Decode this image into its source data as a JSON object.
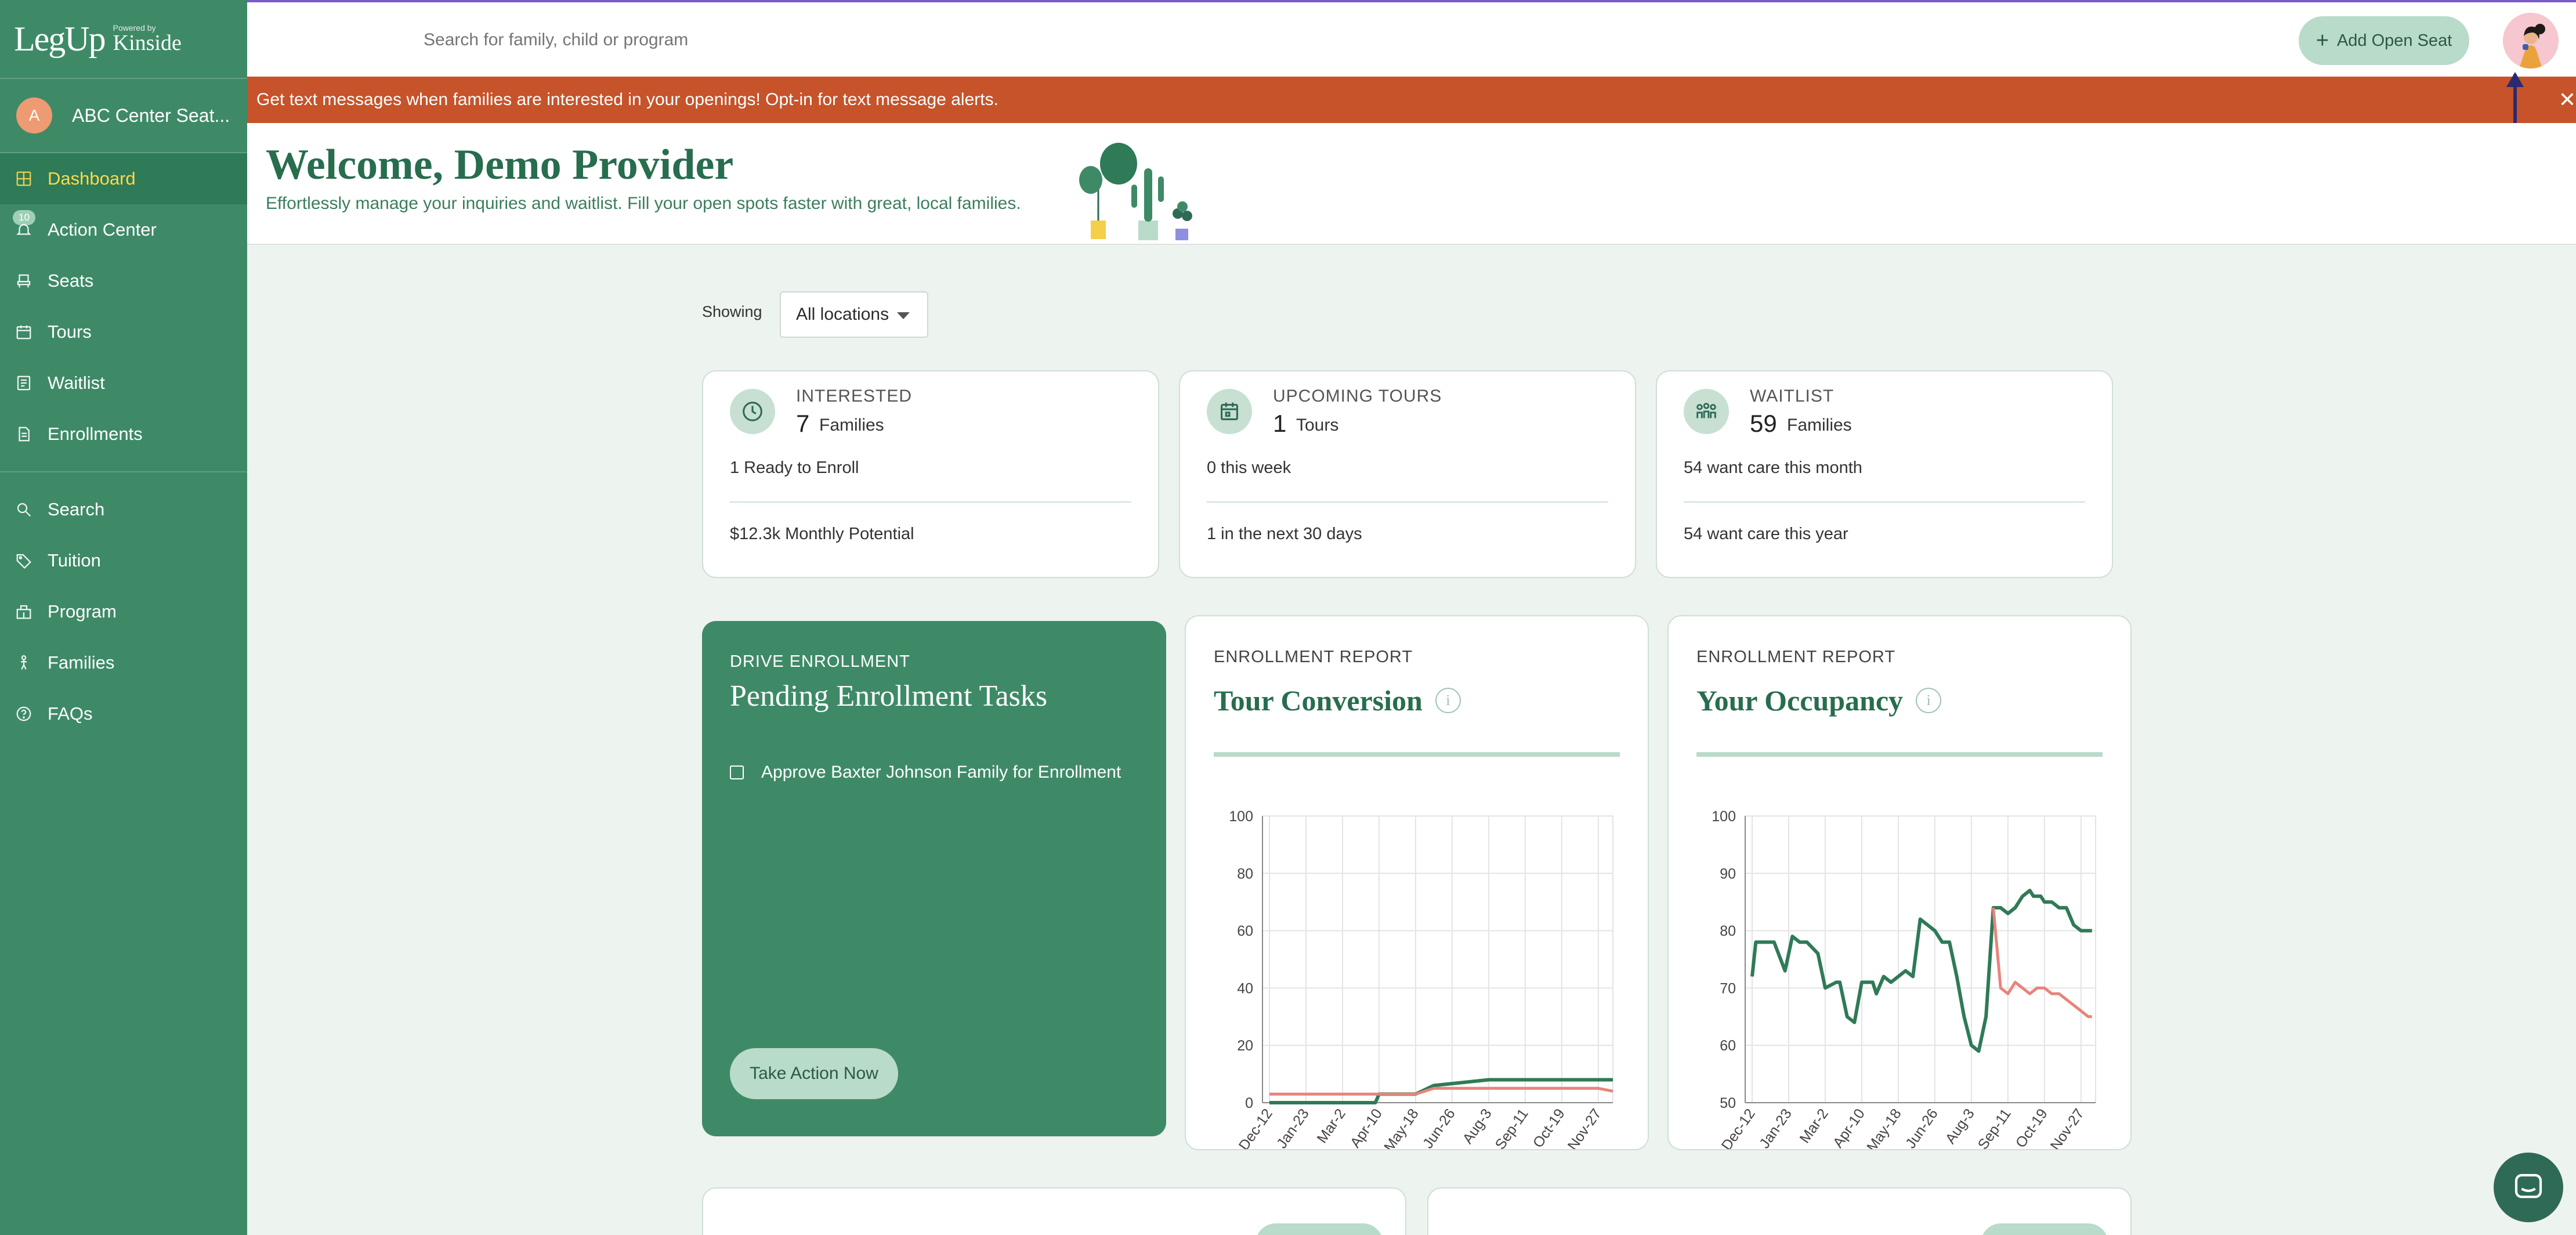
{
  "brand": {
    "logo": "LegUp",
    "powered_by": "Powered by",
    "partner": "Kinside"
  },
  "center": {
    "initial": "A",
    "name": "ABC Center Seat..."
  },
  "nav": {
    "primary": [
      {
        "label": "Dashboard",
        "icon": "dashboard-icon",
        "active": true
      },
      {
        "label": "Action Center",
        "icon": "bell-icon",
        "badge": "10"
      },
      {
        "label": "Seats",
        "icon": "seat-icon"
      },
      {
        "label": "Tours",
        "icon": "calendar-icon"
      },
      {
        "label": "Waitlist",
        "icon": "list-icon"
      },
      {
        "label": "Enrollments",
        "icon": "document-icon"
      }
    ],
    "secondary": [
      {
        "label": "Search",
        "icon": "search-icon"
      },
      {
        "label": "Tuition",
        "icon": "tag-icon"
      },
      {
        "label": "Program",
        "icon": "building-icon"
      },
      {
        "label": "Families",
        "icon": "person-icon"
      },
      {
        "label": "FAQs",
        "icon": "question-icon"
      }
    ]
  },
  "topbar": {
    "search_placeholder": "Search for family, child or program",
    "add_seat_label": "Add Open Seat"
  },
  "banner": {
    "text": "Get text messages when families are interested in your openings! Opt-in for text message alerts."
  },
  "welcome": {
    "title": "Welcome, Demo Provider",
    "subtitle": "Effortlessly manage your inquiries and waitlist. Fill your open spots faster with great, local families."
  },
  "filter": {
    "label": "Showing",
    "value": "All locations"
  },
  "stats": [
    {
      "title": "INTERESTED",
      "number": "7",
      "unit": "Families",
      "line1": "1 Ready to Enroll",
      "line2": "$12.3k Monthly Potential",
      "icon": "clock-icon"
    },
    {
      "title": "UPCOMING TOURS",
      "number": "1",
      "unit": "Tours",
      "line1": "0 this week",
      "line2": "1 in the next 30 days",
      "icon": "calendar-icon"
    },
    {
      "title": "WAITLIST",
      "number": "59",
      "unit": "Families",
      "line1": "54 want care this month",
      "line2": "54 want care this year",
      "icon": "people-icon"
    }
  ],
  "tasks": {
    "kicker": "DRIVE ENROLLMENT",
    "title": "Pending Enrollment Tasks",
    "items": [
      "Approve Baxter Johnson Family for Enrollment"
    ],
    "action_label": "Take Action Now"
  },
  "colors": {
    "primary": "#3e8a67",
    "accent_light": "#b9dbc9",
    "banner": "#c6532a",
    "series_green": "#2f7a57",
    "series_red": "#e8847b"
  },
  "chart_data": [
    {
      "type": "line",
      "kicker": "ENROLLMENT REPORT",
      "title": "Tour Conversion",
      "categories": [
        "Dec-12",
        "Jan-23",
        "Mar-2",
        "Apr-10",
        "May-18",
        "Jun-26",
        "Aug-3",
        "Sep-11",
        "Oct-19",
        "Nov-27"
      ],
      "ylim": [
        0,
        100
      ],
      "yticks": [
        0,
        20,
        40,
        60,
        80,
        100
      ],
      "grid": true,
      "series": [
        {
          "color": "#2f7a57",
          "x": [
            0,
            0.5,
            1,
            2,
            2.9,
            3,
            4,
            4.5,
            6,
            7,
            8,
            9,
            9.4
          ],
          "values": [
            0,
            0,
            0,
            0,
            0,
            3,
            3,
            6,
            8,
            8,
            8,
            8,
            8
          ]
        },
        {
          "color": "#e8847b",
          "x": [
            0,
            1,
            2,
            3,
            4,
            4.5,
            5,
            6,
            7,
            8,
            9,
            9.4
          ],
          "values": [
            3,
            3,
            3,
            3,
            3,
            5,
            5,
            5,
            5,
            5,
            5,
            4
          ]
        }
      ]
    },
    {
      "type": "line",
      "kicker": "ENROLLMENT REPORT",
      "title": "Your Occupancy",
      "categories": [
        "Dec-12",
        "Jan-23",
        "Mar-2",
        "Apr-10",
        "May-18",
        "Jun-26",
        "Aug-3",
        "Sep-11",
        "Oct-19",
        "Nov-27"
      ],
      "ylim": [
        50,
        100
      ],
      "yticks": [
        50,
        60,
        70,
        80,
        90,
        100
      ],
      "grid": true,
      "series": [
        {
          "color": "#2f7a57",
          "x": [
            0,
            0.1,
            0.6,
            0.9,
            1.1,
            1.3,
            1.5,
            1.8,
            2,
            2.3,
            2.4,
            2.6,
            2.8,
            3,
            3.2,
            3.3,
            3.4,
            3.6,
            3.8,
            4,
            4.2,
            4.4,
            4.6,
            4.8,
            5,
            5.2,
            5.4,
            5.6,
            5.8,
            6,
            6.2,
            6.4,
            6.6,
            6.8,
            7,
            7.2,
            7.4,
            7.6,
            7.7,
            7.8,
            7.9,
            8,
            8.2,
            8.4,
            8.6,
            8.8,
            9,
            9.2,
            9.3
          ],
          "values": [
            72,
            78,
            78,
            73,
            79,
            78,
            78,
            76,
            70,
            71,
            71,
            65,
            64,
            71,
            71,
            71,
            69,
            72,
            71,
            72,
            73,
            72,
            82,
            81,
            80,
            78,
            78,
            72,
            65,
            60,
            59,
            65,
            84,
            84,
            83,
            84,
            86,
            87,
            86,
            86,
            86,
            85,
            85,
            84,
            84,
            81,
            80,
            80,
            80
          ]
        },
        {
          "color": "#e8847b",
          "x": [
            6.6,
            6.8,
            7,
            7.2,
            7.4,
            7.6,
            7.8,
            8,
            8.2,
            8.4,
            8.6,
            8.8,
            9,
            9.2,
            9.3
          ],
          "values": [
            84,
            70,
            69,
            71,
            70,
            69,
            70,
            70,
            69,
            69,
            68,
            67,
            66,
            65,
            65
          ]
        }
      ]
    }
  ]
}
